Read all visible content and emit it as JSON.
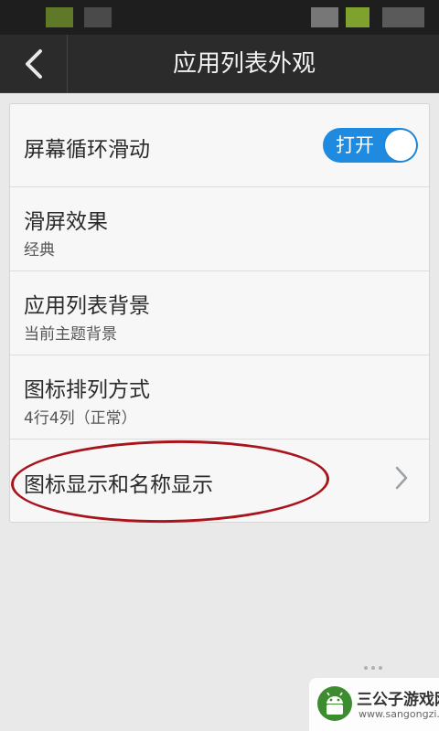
{
  "header": {
    "title": "应用列表外观",
    "back_icon": "chevron-left-icon"
  },
  "settings": {
    "screen_loop": {
      "title": "屏幕循环滑动",
      "toggle_label": "打开",
      "toggle_on": true
    },
    "slide_effect": {
      "title": "滑屏效果",
      "value": "经典"
    },
    "app_list_background": {
      "title": "应用列表背景",
      "value": "当前主题背景"
    },
    "icon_arrangement": {
      "title": "图标排列方式",
      "value": "4行4列（正常）"
    },
    "icon_name_display": {
      "title": "图标显示和名称显示",
      "icon": "chevron-right-icon"
    }
  },
  "watermark": {
    "name": "三公子游戏网",
    "url": "www.sangongzi.net"
  },
  "colors": {
    "accent": "#1f8be0",
    "action_bar": "#2b2b2b",
    "annotation": "#a8141c"
  }
}
